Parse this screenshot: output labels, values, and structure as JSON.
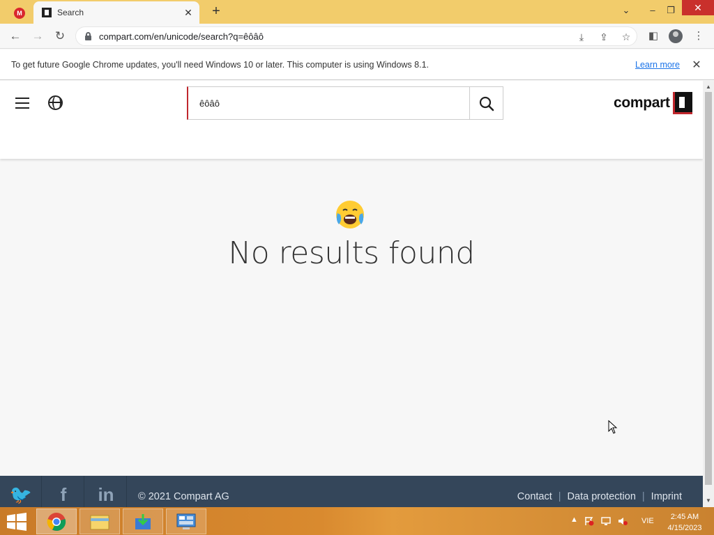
{
  "browser": {
    "inactive_tab_icon": "mega-icon",
    "active_tab_title": "Search",
    "url": "compart.com/en/unicode/search?q=êôâô",
    "infobar_text": "To get future Google Chrome updates, you'll need Windows 10 or later. This computer is using Windows 8.1.",
    "infobar_link": "Learn more"
  },
  "site": {
    "search_value": "êôâô",
    "logo_text": "compart",
    "no_results_text": "No results found",
    "emoji": "loudly-crying-face",
    "brand_red": "#c0272d"
  },
  "footer": {
    "social": [
      "twitter",
      "facebook",
      "linkedin"
    ],
    "copyright": "© 2021 Compart AG",
    "links": [
      "Contact",
      "Data protection",
      "Imprint"
    ],
    "background": "#34465a"
  },
  "taskbar": {
    "apps": [
      "chrome",
      "file-explorer",
      "download-app",
      "control-panel"
    ],
    "language": "VIE",
    "time": "2:45 AM",
    "date": "4/15/2023"
  }
}
